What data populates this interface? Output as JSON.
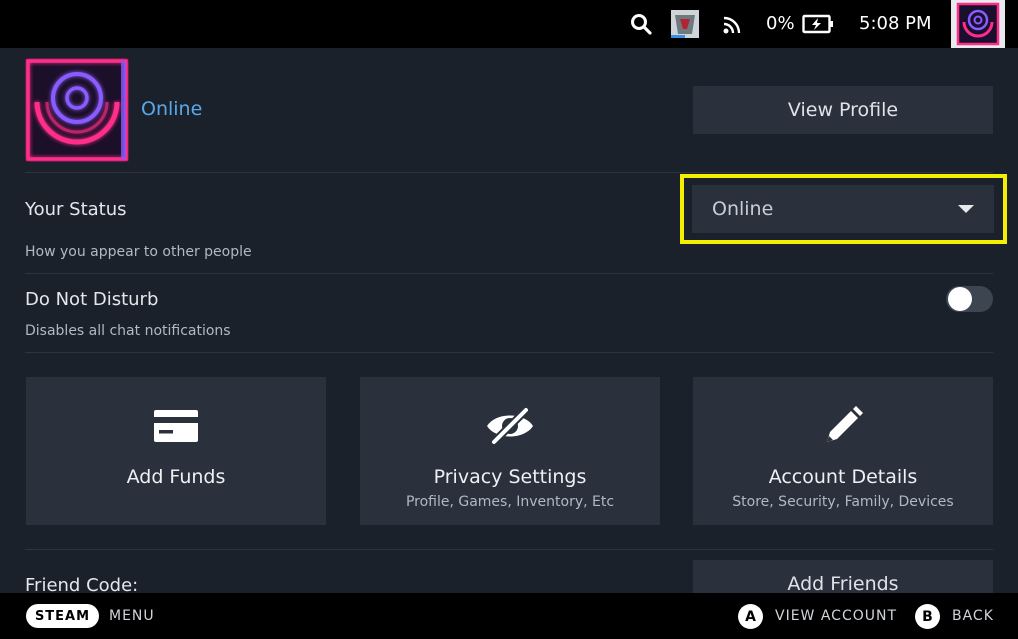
{
  "topbar": {
    "icons": [
      "search-icon",
      "game-thumbnail-icon",
      "wifi-icon",
      "battery-charging-icon",
      "user-avatar-icon"
    ],
    "battery_percent": "0%",
    "time": "5:08 PM"
  },
  "profile": {
    "status_label": "Online",
    "view_profile_label": "View Profile",
    "avatar_colors": {
      "pink": "#ff2d8a",
      "purple": "#8a5cff"
    }
  },
  "your_status": {
    "title": "Your Status",
    "subtitle": "How you appear to other people",
    "selected": "Online"
  },
  "do_not_disturb": {
    "title": "Do Not Disturb",
    "subtitle": "Disables all chat notifications",
    "enabled": false
  },
  "tiles": [
    {
      "title": "Add Funds",
      "subtitle": "",
      "icon": "credit-card-icon"
    },
    {
      "title": "Privacy Settings",
      "subtitle": "Profile, Games, Inventory, Etc",
      "icon": "eye-slash-icon"
    },
    {
      "title": "Account Details",
      "subtitle": "Store, Security, Family, Devices",
      "icon": "pencil-icon"
    }
  ],
  "friends": {
    "friend_code_label": "Friend Code:",
    "add_friends_label": "Add Friends"
  },
  "bottombar": {
    "steam_label": "STEAM",
    "menu_label": "MENU",
    "a_glyph": "A",
    "a_label": "VIEW ACCOUNT",
    "b_glyph": "B",
    "b_label": "BACK"
  },
  "colors": {
    "focus_ring": "#f4ee00",
    "online_text": "#5ba8e8",
    "panel_bg": "#1a212b",
    "tile_bg": "#2a313c"
  }
}
